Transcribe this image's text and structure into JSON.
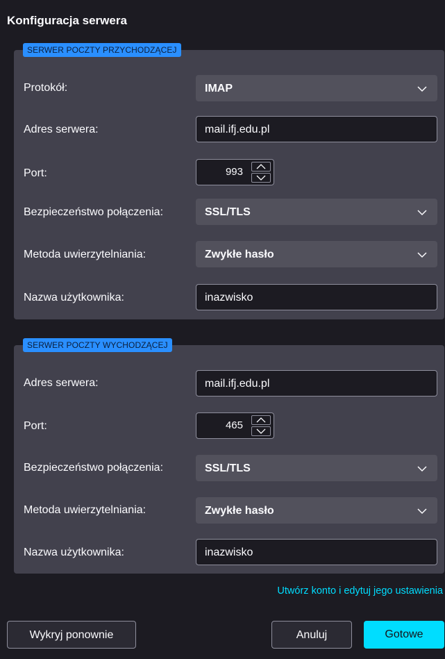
{
  "dialog": {
    "title": "Konfiguracja serwera"
  },
  "incoming": {
    "legend": "SERWER POCZTY PRZYCHODZĄCEJ",
    "protocol_label": "Protokół:",
    "protocol_value": "IMAP",
    "server_label": "Adres serwera:",
    "server_value": "mail.ifj.edu.pl",
    "port_label": "Port:",
    "port_value": "993",
    "security_label": "Bezpieczeństwo połączenia:",
    "security_value": "SSL/TLS",
    "auth_label": "Metoda uwierzytelniania:",
    "auth_value": "Zwykłe hasło",
    "user_label": "Nazwa użytkownika:",
    "user_value": "inazwisko"
  },
  "outgoing": {
    "legend": "SERWER POCZTY WYCHODZĄCEJ",
    "server_label": "Adres serwera:",
    "server_value": "mail.ifj.edu.pl",
    "port_label": "Port:",
    "port_value": "465",
    "security_label": "Bezpieczeństwo połączenia:",
    "security_value": "SSL/TLS",
    "auth_label": "Metoda uwierzytelniania:",
    "auth_value": "Zwykłe hasło",
    "user_label": "Nazwa użytkownika:",
    "user_value": "inazwisko"
  },
  "advanced_link": "Utwórz konto i edytuj jego ustawienia",
  "buttons": {
    "redetect": "Wykryj ponownie",
    "cancel": "Anuluj",
    "done": "Gotowe"
  },
  "colors": {
    "background": "#1c1b22",
    "section": "#42414d",
    "accent": "#00ddff",
    "legend": "#2a8fff"
  }
}
